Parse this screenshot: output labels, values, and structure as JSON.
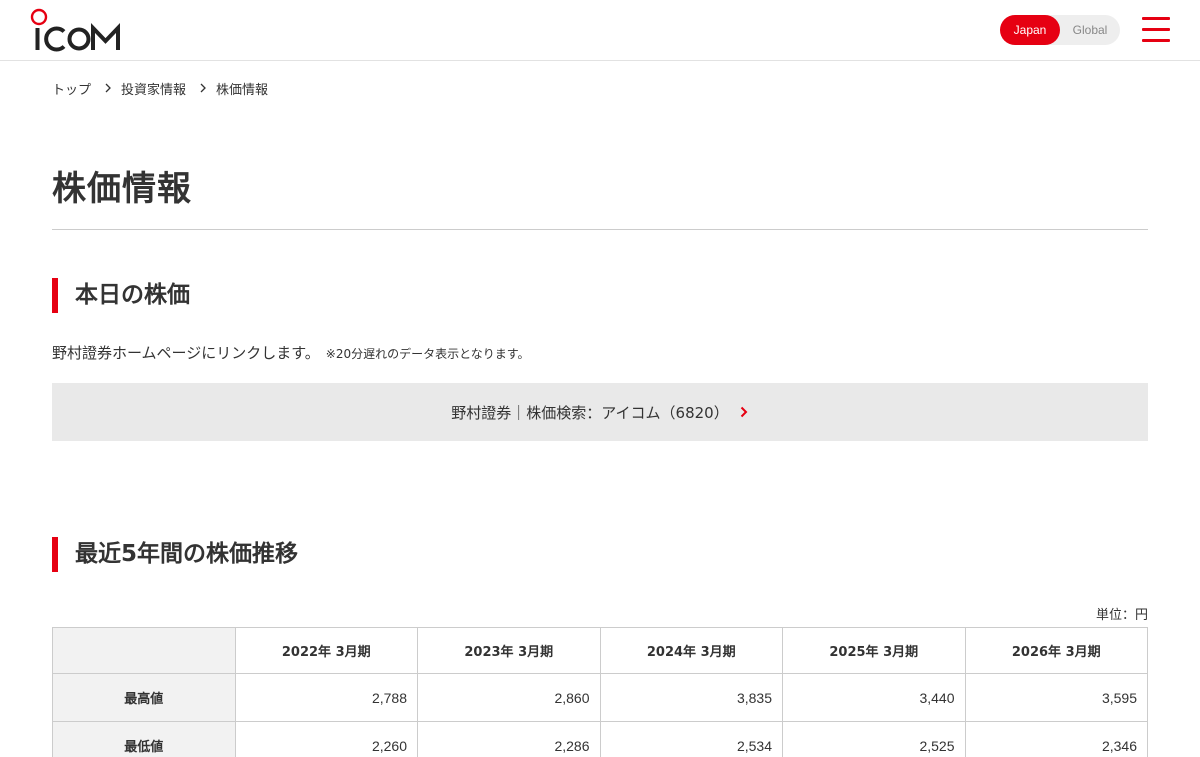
{
  "header": {
    "logo_text": "ICOM",
    "lang": {
      "japan": "Japan",
      "global": "Global"
    },
    "brand_color": "#e60012",
    "menu_icon": "hamburger-menu-icon"
  },
  "breadcrumb": {
    "items": [
      "トップ",
      "投資家情報",
      "株価情報"
    ],
    "separator_icon": "chevron-right-icon"
  },
  "page": {
    "title": "株価情報"
  },
  "today": {
    "heading": "本日の株価",
    "description": "野村證券ホームページにリンクします。",
    "note": "※20分遅れのデータ表示となります。",
    "link_label": "野村證券｜株価検索：アイコム（6820）",
    "link_icon": "chevron-right-icon"
  },
  "history": {
    "heading": "最近5年間の株価推移",
    "unit": "単位：円",
    "columns": [
      "2022年 3月期",
      "2023年 3月期",
      "2024年 3月期",
      "2025年 3月期",
      "2026年 3月期"
    ],
    "rows": [
      {
        "label": "最高値",
        "values": [
          "2,788",
          "2,860",
          "3,835",
          "3,440",
          "3,595"
        ]
      },
      {
        "label": "最低値",
        "values": [
          "2,260",
          "2,286",
          "2,534",
          "2,525",
          "2,346"
        ]
      }
    ]
  }
}
